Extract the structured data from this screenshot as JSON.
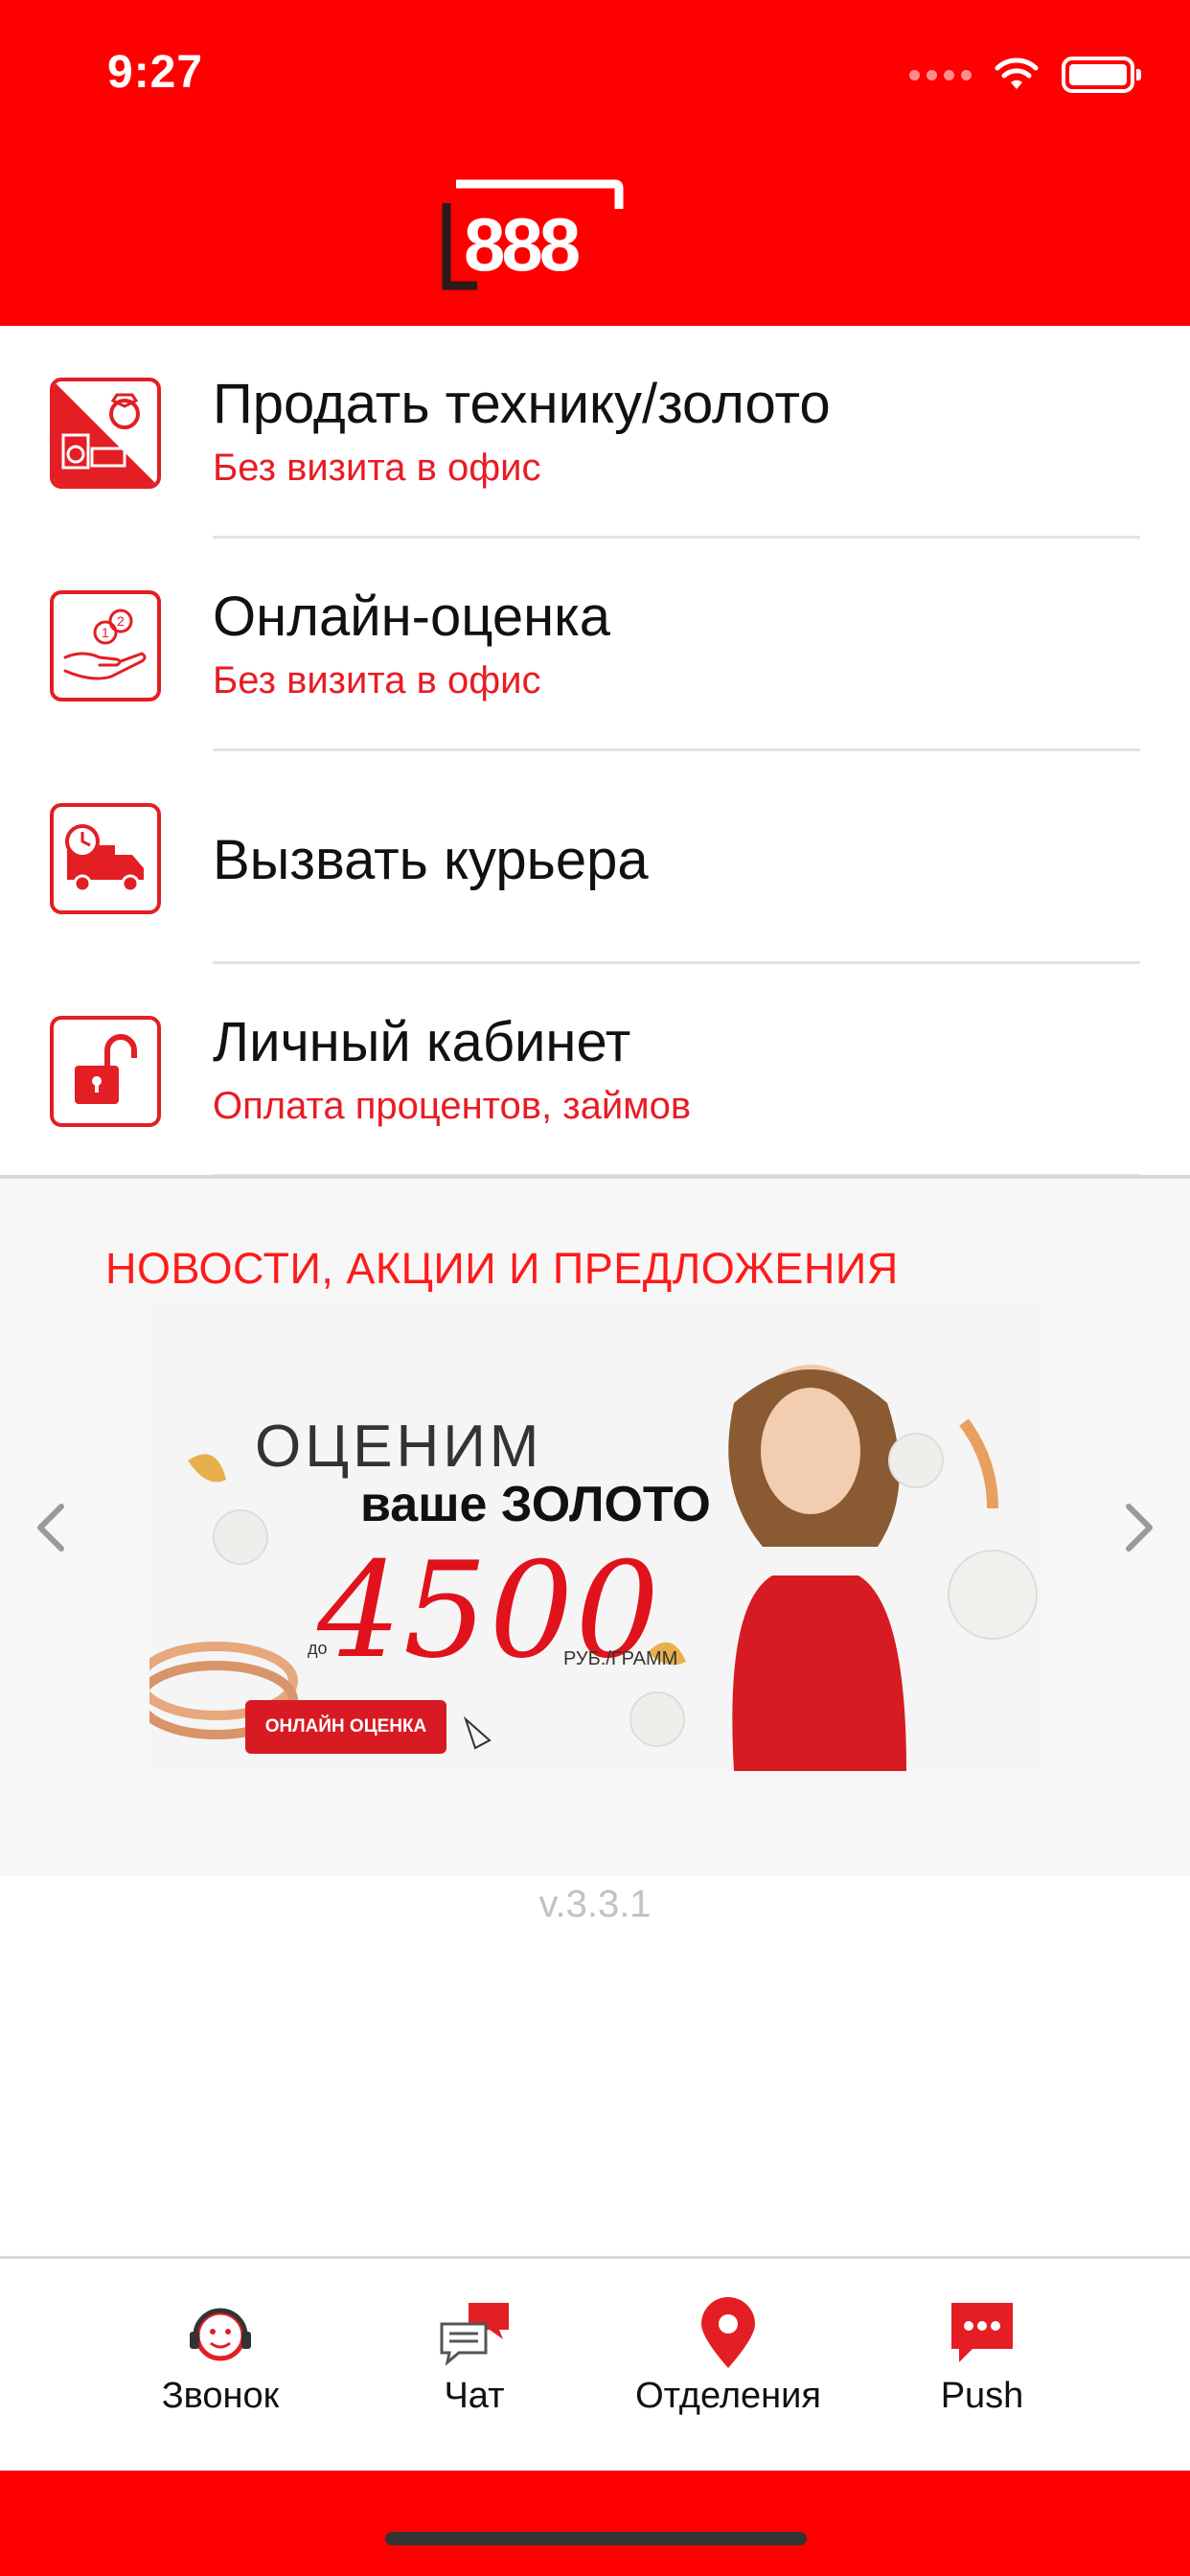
{
  "status_bar": {
    "time": "9:27"
  },
  "header": {
    "logo_text": "888"
  },
  "menu": {
    "items": [
      {
        "title": "Продать технику/золото",
        "subtitle": "Без визита в офис",
        "icon": "sell-gold-appliance-icon"
      },
      {
        "title": "Онлайн-оценка",
        "subtitle": "Без визита в офис",
        "icon": "hand-coins-icon"
      },
      {
        "title": "Вызвать курьера",
        "subtitle": "",
        "icon": "courier-truck-icon"
      },
      {
        "title": "Личный кабинет",
        "subtitle": "Оплата процентов, займов",
        "icon": "unlock-icon"
      }
    ]
  },
  "news": {
    "title": "НОВОСТИ, АКЦИИ И ПРЕДЛОЖЕНИЯ",
    "banner": {
      "line1": "ОЦЕНИМ",
      "line2": "ваше ЗОЛОТО",
      "prefix": "до",
      "price": "4500",
      "unit": "РУБ./ГРАММ",
      "button": "ОНЛАЙН ОЦЕНКА"
    }
  },
  "version": "v.3.3.1",
  "tabbar": {
    "items": [
      {
        "label": "Звонок",
        "icon": "headset-icon"
      },
      {
        "label": "Чат",
        "icon": "chat-bubbles-icon"
      },
      {
        "label": "Отделения",
        "icon": "map-pin-icon"
      },
      {
        "label": "Push",
        "icon": "push-message-icon"
      }
    ]
  },
  "colors": {
    "brand_red": "#ff0000",
    "accent_red": "#e31e24",
    "text": "#111111",
    "muted": "#c2c2c2"
  }
}
